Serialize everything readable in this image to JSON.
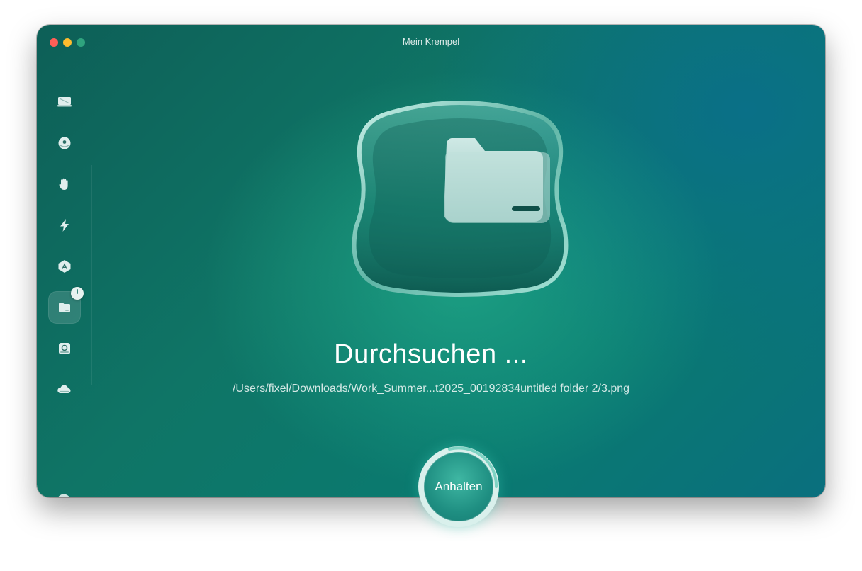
{
  "window": {
    "title": "Mein Krempel"
  },
  "sidebar": {
    "items": [
      {
        "name": "smart-scan",
        "icon": "monitor-icon"
      },
      {
        "name": "cleanup",
        "icon": "disc-icon"
      },
      {
        "name": "protection",
        "icon": "hand-icon"
      },
      {
        "name": "performance",
        "icon": "bolt-icon"
      },
      {
        "name": "applications",
        "icon": "app-store-icon"
      },
      {
        "name": "my-clutter",
        "icon": "folder-icon",
        "active": true
      },
      {
        "name": "space-lens",
        "icon": "drive-icon"
      },
      {
        "name": "cloud-cleanup",
        "icon": "cloud-icon"
      }
    ],
    "assistant_icon": "assistant-icon"
  },
  "main": {
    "headline": "Durchsuchen ...",
    "current_path": "/Users/fixel/Downloads/Work_Summer...t2025_00192834untitled folder 2/3.png",
    "stop_button_label": "Anhalten"
  },
  "colors": {
    "accent": "#1f8f82",
    "background_start": "#0d5f57",
    "background_end": "#0a6f7e"
  }
}
